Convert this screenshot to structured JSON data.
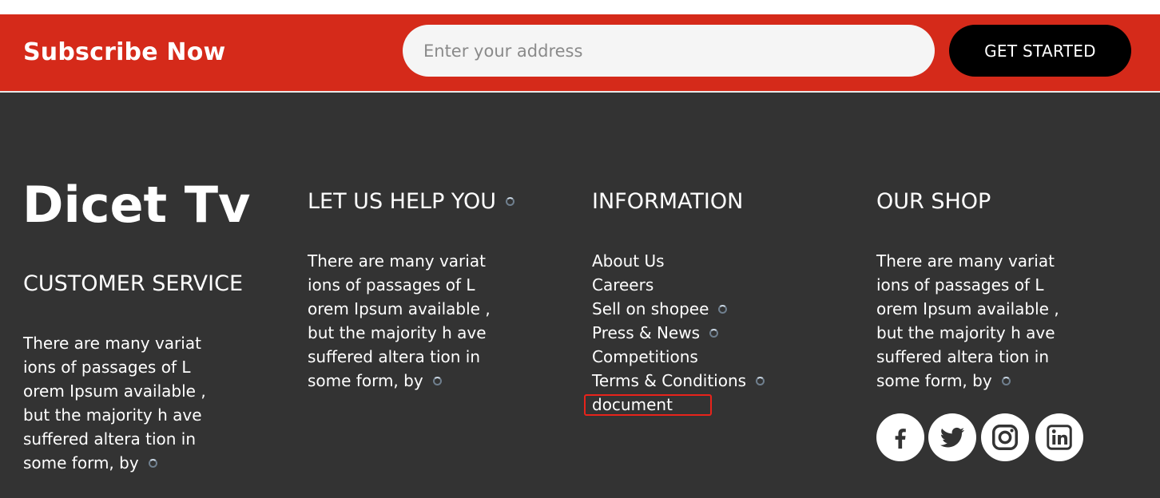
{
  "subscribe": {
    "title": "Subscribe Now",
    "placeholder": "Enter your address",
    "button_label": "GET STARTED",
    "bar_color": "#d52a1a"
  },
  "footer": {
    "logo": "Dicet Tv",
    "customer_service": {
      "heading": "CUSTOMER SERVICE",
      "lines": [
        "There are many variat",
        "ions of passages of L",
        "orem Ipsum available ,",
        "but the majority h ave",
        "suffered altera tion in",
        "some form, by"
      ]
    },
    "help": {
      "heading": "LET US HELP YOU",
      "lines": [
        "There are many variat",
        "ions of passages of L",
        "orem Ipsum available ,",
        "but the majority h ave",
        "suffered altera tion in",
        "some form, by"
      ]
    },
    "information": {
      "heading": "INFORMATION",
      "links": [
        "About Us",
        "Careers",
        "Sell on shopee",
        "Press & News",
        "Competitions",
        "Terms & Conditions",
        "document"
      ]
    },
    "shop": {
      "heading": "OUR SHOP",
      "lines": [
        "There are many variat",
        "ions of passages of L",
        "orem Ipsum available ,",
        "but the majority h ave",
        "suffered altera tion in",
        "some form, by"
      ]
    },
    "social_icons": [
      "facebook-icon",
      "twitter-icon",
      "instagram-icon",
      "linkedin-icon"
    ],
    "background_color": "#333333"
  }
}
